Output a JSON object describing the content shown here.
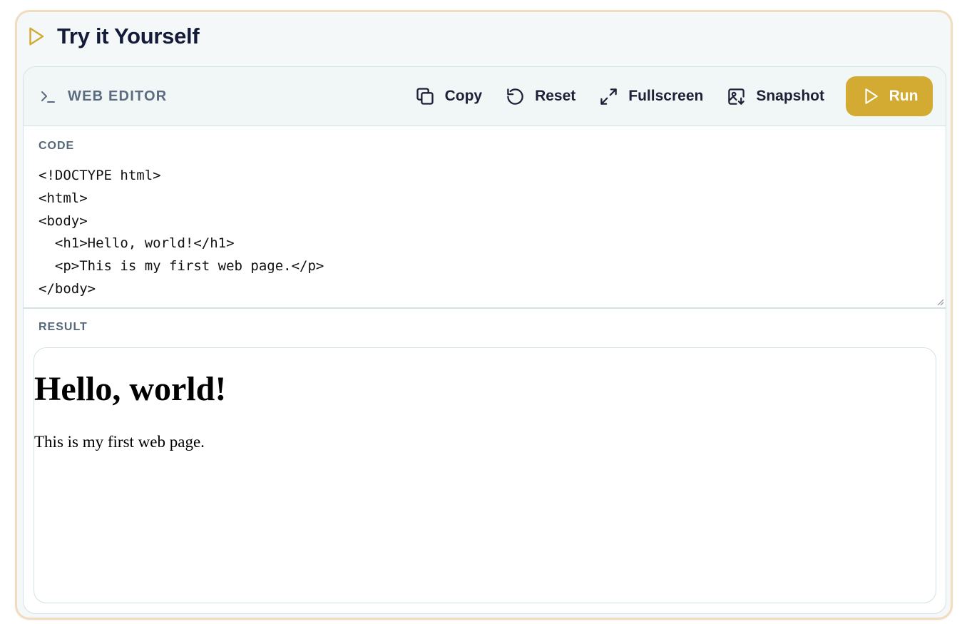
{
  "card": {
    "title": "Try it Yourself",
    "icon": "play-icon",
    "accent_color": "#d4ab32",
    "border_color": "#f1dcc0"
  },
  "editor": {
    "label": "WEB EDITOR",
    "icon": "terminal-icon"
  },
  "toolbar": {
    "copy_label": "Copy",
    "copy_icon": "copy-icon",
    "reset_label": "Reset",
    "reset_icon": "rotate-ccw-icon",
    "fullscreen_label": "Fullscreen",
    "fullscreen_icon": "maximize-icon",
    "snapshot_label": "Snapshot",
    "snapshot_icon": "image-download-icon",
    "run_label": "Run",
    "run_icon": "play-icon",
    "run_color": "#d4ab32"
  },
  "code": {
    "label": "CODE",
    "content": "<!DOCTYPE html>\n<html>\n<body>\n  <h1>Hello, world!</h1>\n  <p>This is my first web page.</p>\n</body>"
  },
  "result": {
    "label": "RESULT",
    "heading": "Hello, world!",
    "paragraph": "This is my first web page."
  }
}
